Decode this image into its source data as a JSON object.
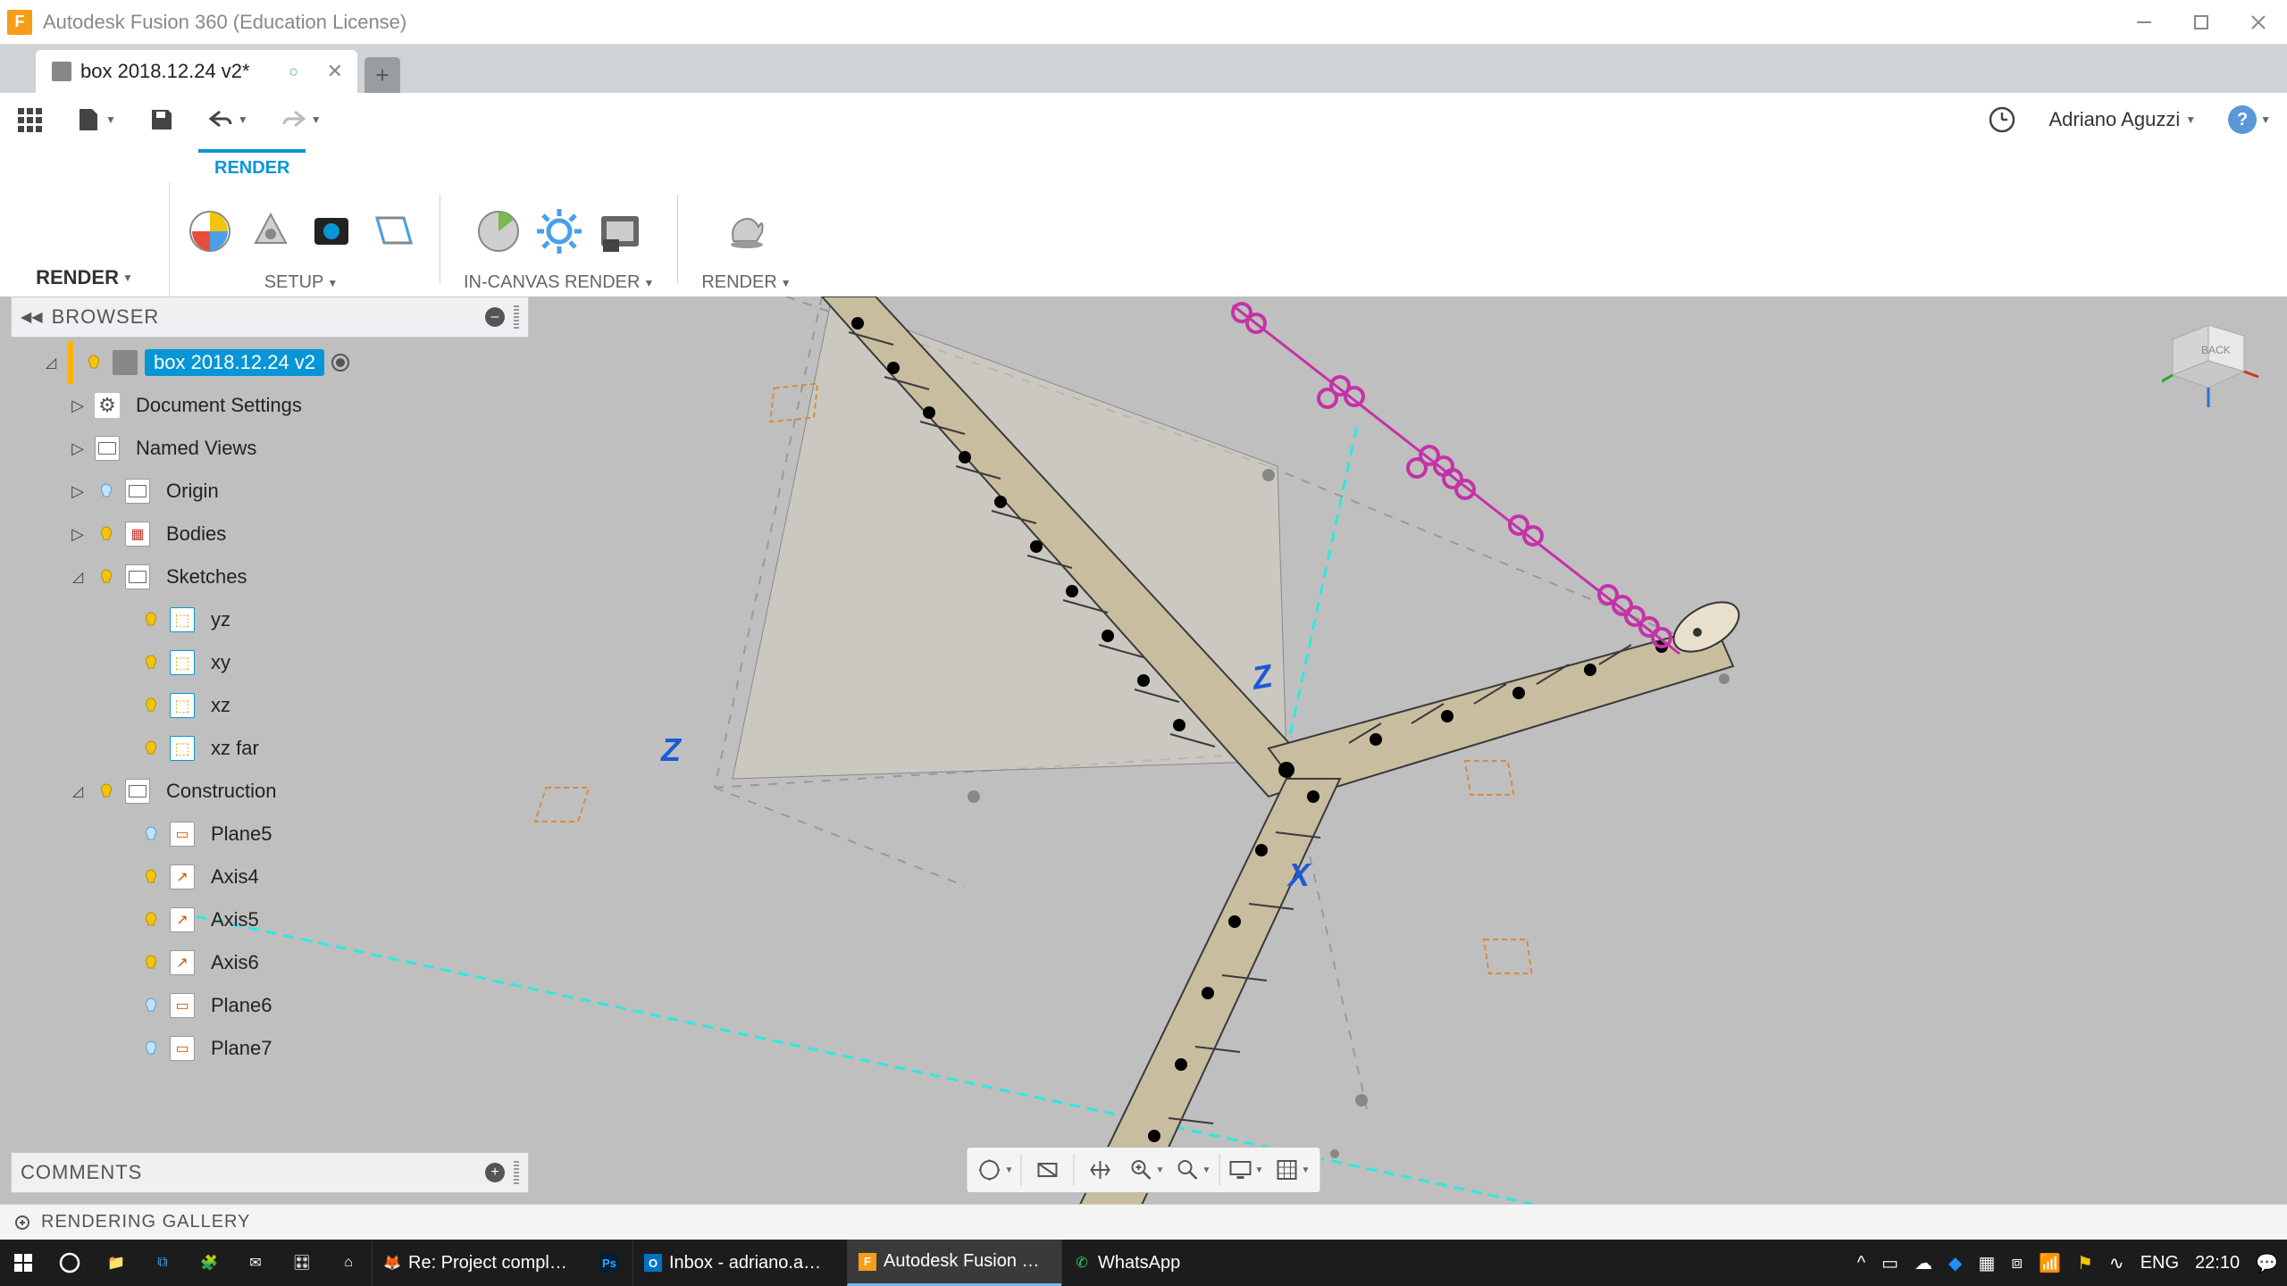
{
  "titlebar": {
    "app_name": "Autodesk Fusion 360 (Education License)"
  },
  "tab": {
    "label": "box 2018.12.24 v2*"
  },
  "quickbar": {
    "user": "Adriano Aguzzi"
  },
  "ribbon": {
    "active_tab": "RENDER",
    "workspace_btn": "RENDER",
    "group_setup": "SETUP",
    "group_incanvas": "IN-CANVAS RENDER",
    "group_render": "RENDER"
  },
  "browser": {
    "title": "BROWSER",
    "root": "box 2018.12.24 v2",
    "items": {
      "doc_settings": "Document Settings",
      "named_views": "Named Views",
      "origin": "Origin",
      "bodies": "Bodies",
      "sketches": "Sketches",
      "yz": "yz",
      "xy": "xy",
      "xz": "xz",
      "xz_far": "xz far",
      "construction": "Construction",
      "plane5": "Plane5",
      "axis4": "Axis4",
      "axis5": "Axis5",
      "axis6": "Axis6",
      "plane6": "Plane6",
      "plane7": "Plane7"
    }
  },
  "comments": {
    "title": "COMMENTS"
  },
  "gallery": {
    "title": "RENDERING GALLERY"
  },
  "taskbar": {
    "apps": [
      {
        "label": "Re: Project compl…",
        "icon": "firefox"
      },
      {
        "label": "",
        "icon": "ps"
      },
      {
        "label": "Inbox - adriano.a…",
        "icon": "outlook"
      },
      {
        "label": "Autodesk Fusion …",
        "icon": "fusion",
        "active": true
      },
      {
        "label": "WhatsApp",
        "icon": "whatsapp"
      }
    ],
    "lang": "ENG",
    "time": "22:10"
  }
}
